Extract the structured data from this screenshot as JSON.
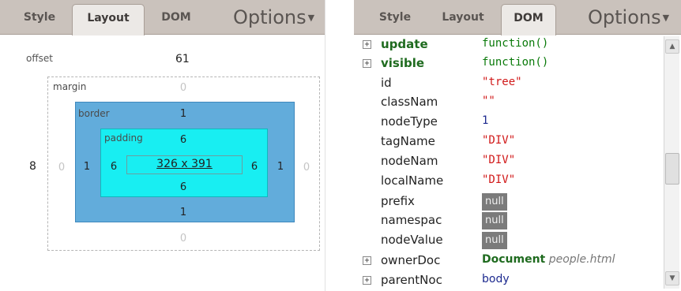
{
  "left_panel": {
    "tabs": [
      "Style",
      "Layout",
      "DOM"
    ],
    "active_tab": "Layout",
    "options_label": "Options",
    "layout": {
      "offset_label": "offset",
      "offset_top": "61",
      "offset_left": "8",
      "margin": {
        "label": "margin",
        "top": "0",
        "right": "0",
        "bottom": "0",
        "left": "0"
      },
      "border": {
        "label": "border",
        "top": "1",
        "right": "1",
        "bottom": "1",
        "left": "1"
      },
      "padding": {
        "label": "padding",
        "top": "6",
        "right": "6",
        "bottom": "6",
        "left": "6"
      },
      "content_size": "326 x 391"
    }
  },
  "right_panel": {
    "tabs": [
      "Style",
      "Layout",
      "DOM"
    ],
    "active_tab": "DOM",
    "options_label": "Options",
    "rows": [
      {
        "name": "update",
        "value": "function()",
        "kind": "func",
        "expandable": true,
        "bold": true
      },
      {
        "name": "visible",
        "value": "function()",
        "kind": "func",
        "expandable": true,
        "bold": true
      },
      {
        "name": "id",
        "value": "\"tree\"",
        "kind": "str",
        "expandable": false,
        "bold": false
      },
      {
        "name": "classNam",
        "value": "\"\"",
        "kind": "str",
        "expandable": false,
        "bold": false
      },
      {
        "name": "nodeType",
        "value": "1",
        "kind": "num",
        "expandable": false,
        "bold": false
      },
      {
        "name": "tagName",
        "value": "\"DIV\"",
        "kind": "str",
        "expandable": false,
        "bold": false
      },
      {
        "name": "nodeNam",
        "value": "\"DIV\"",
        "kind": "str",
        "expandable": false,
        "bold": false
      },
      {
        "name": "localName",
        "value": "\"DIV\"",
        "kind": "str",
        "expandable": false,
        "bold": false
      },
      {
        "name": "prefix",
        "value": "null",
        "kind": "null",
        "expandable": false,
        "bold": false
      },
      {
        "name": "namespac",
        "value": "null",
        "kind": "null",
        "expandable": false,
        "bold": false
      },
      {
        "name": "nodeValue",
        "value": "null",
        "kind": "null",
        "expandable": false,
        "bold": false
      },
      {
        "name": "ownerDoc",
        "value_strong": "Document",
        "value_em": "people.html",
        "kind": "doc",
        "expandable": true,
        "bold": false
      },
      {
        "name": "parentNoc",
        "value": "body",
        "kind": "obj",
        "expandable": true,
        "bold": false
      }
    ]
  }
}
